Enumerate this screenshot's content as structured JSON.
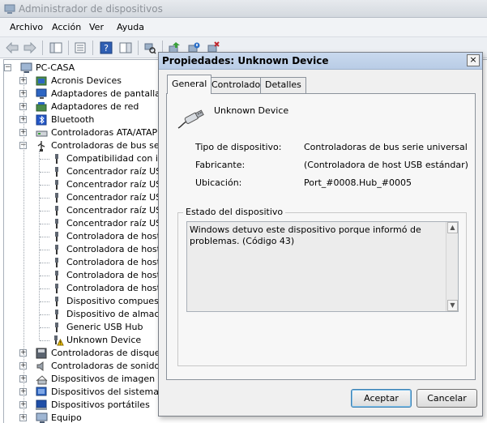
{
  "window": {
    "title": "Administrador de dispositivos"
  },
  "menu": {
    "items": [
      "Archivo",
      "Acción",
      "Ver",
      "Ayuda"
    ]
  },
  "tree": {
    "root": "PC-CASA",
    "categories_top": [
      {
        "label": "Acronis Devices",
        "icon": "device-icon"
      },
      {
        "label": "Adaptadores de pantalla",
        "icon": "monitor-icon"
      },
      {
        "label": "Adaptadores de red",
        "icon": "network-icon"
      },
      {
        "label": "Bluetooth",
        "icon": "bluetooth-icon"
      },
      {
        "label": "Controladoras ATA/ATAPI",
        "icon": "disk-controller-icon"
      },
      {
        "label": "Controladoras de bus serie",
        "icon": "usb-icon"
      }
    ],
    "usb_children": [
      "Compatibilidad con imp",
      "Concentrador raíz USB",
      "Concentrador raíz USB",
      "Concentrador raíz USB",
      "Concentrador raíz USB",
      "Concentrador raíz USB",
      "Controladora de host u",
      "Controladora de host u",
      "Controladora de host u",
      "Controladora de host u",
      "Controladora de host u",
      "Dispositivo compuesto",
      "Dispositivo de almacen",
      "Generic USB Hub",
      "Unknown Device"
    ],
    "categories_bottom": [
      {
        "label": "Controladoras de disquete",
        "icon": "floppy-icon"
      },
      {
        "label": "Controladoras de sonido y",
        "icon": "speaker-icon"
      },
      {
        "label": "Dispositivos de imagen",
        "icon": "camera-icon"
      },
      {
        "label": "Dispositivos del sistema",
        "icon": "system-icon"
      },
      {
        "label": "Dispositivos portátiles",
        "icon": "portable-icon"
      },
      {
        "label": "Equipo",
        "icon": "computer-icon"
      }
    ]
  },
  "dialog": {
    "title": "Propiedades: Unknown Device",
    "close_label": "×",
    "tabs": [
      "General",
      "Controlador",
      "Detalles"
    ],
    "active_tab": "General",
    "device_name": "Unknown Device",
    "properties": [
      {
        "label": "Tipo de dispositivo:",
        "value": "Controladoras de bus serie universal"
      },
      {
        "label": "Fabricante:",
        "value": "(Controladora de host USB estándar)"
      },
      {
        "label": "Ubicación:",
        "value": "Port_#0008.Hub_#0005"
      }
    ],
    "status_group": "Estado del dispositivo",
    "status_text": "Windows detuvo este dispositivo porque informó de problemas. (Código 43)",
    "buttons": {
      "ok": "Aceptar",
      "cancel": "Cancelar"
    }
  },
  "colors": {
    "title_active": "#b9cce6",
    "title_inactive": "#d4d9df",
    "warning": "#f2c200"
  }
}
